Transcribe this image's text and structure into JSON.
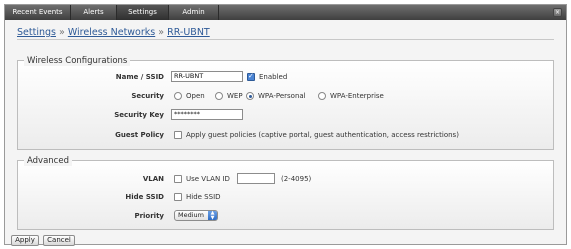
{
  "tabs": [
    {
      "label": "Recent Events"
    },
    {
      "label": "Alerts"
    },
    {
      "label": "Settings"
    },
    {
      "label": "Admin"
    }
  ],
  "breadcrumb": {
    "settings": "Settings",
    "sep1": "»",
    "wireless_networks": "Wireless Networks",
    "sep2": "»",
    "current": "RR-UBNT"
  },
  "wireless": {
    "legend": "Wireless Configurations",
    "name_label": "Name / SSID",
    "name_value": "RR-UBNT",
    "enabled_label": "Enabled",
    "enabled_checked": true,
    "security_label": "Security",
    "security_options": [
      "Open",
      "WEP",
      "WPA-Personal",
      "WPA-Enterprise"
    ],
    "security_selected": "WPA-Personal",
    "key_label": "Security Key",
    "key_value": "********",
    "guest_label": "Guest Policy",
    "guest_text": "Apply guest policies (captive portal, guest authentication, access restrictions)",
    "guest_checked": false
  },
  "advanced": {
    "legend": "Advanced",
    "vlan_label": "VLAN",
    "vlan_text": "Use VLAN ID",
    "vlan_checked": false,
    "vlan_value": "",
    "vlan_range": "(2-4095)",
    "hide_label": "Hide SSID",
    "hide_text": "Hide SSID",
    "hide_checked": false,
    "priority_label": "Priority",
    "priority_value": "Medium"
  },
  "buttons": {
    "apply": "Apply",
    "cancel": "Cancel"
  }
}
